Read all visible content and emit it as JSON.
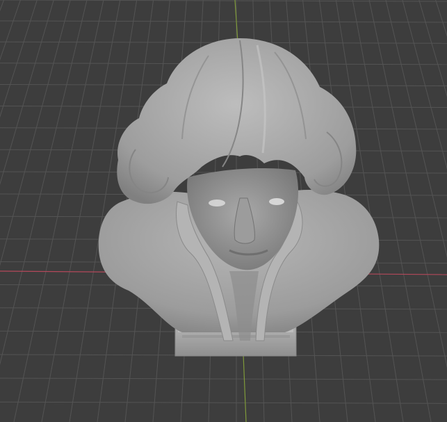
{
  "viewport": {
    "background_color": "#3d3d3d",
    "grid_color": "#545454",
    "x_axis_color": "#b3485a",
    "y_axis_color": "#7f9a3a"
  },
  "model": {
    "type": "sculpted-bust",
    "material_color": "#a6a6a6",
    "pedestal_color": "#b0b0b0"
  }
}
